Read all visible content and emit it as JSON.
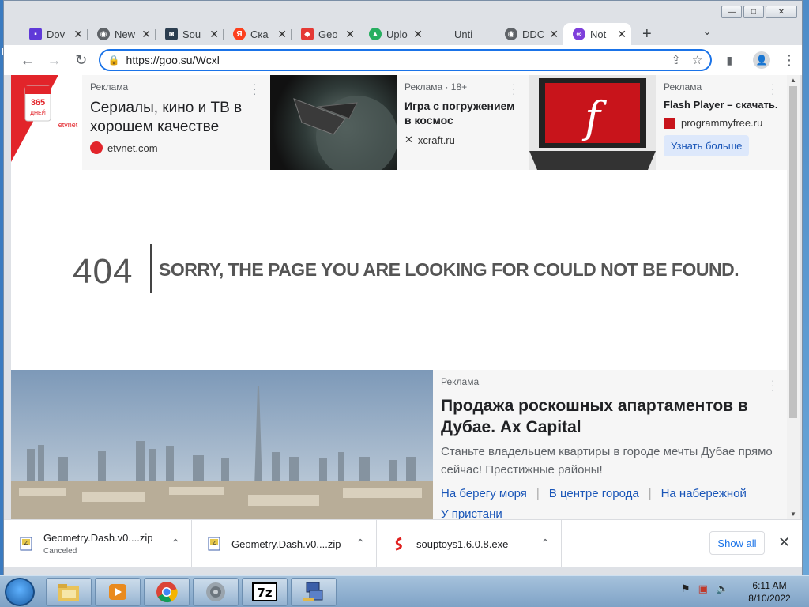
{
  "desktop": {
    "letter": "M"
  },
  "window": {
    "min": "—",
    "max": "□",
    "close": "✕"
  },
  "tabs": [
    {
      "title": "Dov",
      "fav_color": "#5f39d8",
      "fav_glyph": "▪"
    },
    {
      "title": "New",
      "fav_color": "#5f6368",
      "fav_glyph": "◉"
    },
    {
      "title": "Sou",
      "fav_color": "#2c3e50",
      "fav_glyph": "◙"
    },
    {
      "title": "Ска",
      "fav_color": "#fc3f1d",
      "fav_glyph": "Я"
    },
    {
      "title": "Geo",
      "fav_color": "#e53935",
      "fav_glyph": "◆"
    },
    {
      "title": "Uplo",
      "fav_color": "#27ae60",
      "fav_glyph": "▲"
    },
    {
      "title": "Unti",
      "fav_color": "#ffffff",
      "fav_glyph": ""
    },
    {
      "title": "DDC",
      "fav_color": "#5f6368",
      "fav_glyph": "◉"
    },
    {
      "title": "Not",
      "fav_color": "#7e3fdb",
      "fav_glyph": "∞"
    }
  ],
  "tab_close": "✕",
  "new_tab": "+",
  "tab_menu": "⌄",
  "toolbar": {
    "back": "←",
    "forward": "→",
    "reload": "↻",
    "lock": "🔒",
    "url": "https://goo.su/Wcxl",
    "share": "⇪",
    "star": "☆",
    "sidebar": "▮",
    "profile": "👤",
    "menu": "⋮"
  },
  "ads_top": [
    {
      "label": "Реклама",
      "title": "Сериалы, кино и ТВ в хорошем качестве",
      "domain": "etvnet.com",
      "calendar": "365",
      "calendar_sub": "ДНЕЙ",
      "brand": "etvnet"
    },
    {
      "label": "Реклама · 18+",
      "title": "Игра с погружением в космос",
      "domain": "xcraft.ru"
    },
    {
      "label": "Реклама",
      "title": "Flash Player – скачать.",
      "domain": "programmyfree.ru",
      "cta": "Узнать больше"
    }
  ],
  "error": {
    "code": "404",
    "message": "SORRY, THE PAGE YOU ARE LOOKING FOR COULD NOT BE FOUND."
  },
  "big_ad": {
    "label": "Реклама",
    "title": "Продажа роскошных апартаментов в Дубае. Ax Capital",
    "text": "Станьте владельцем квартиры в городе мечты Дубае прямо сейчас! Престижные районы!",
    "links": [
      "На берегу моря",
      "В центре города",
      "На набережной",
      "У пристани"
    ]
  },
  "downloads": [
    {
      "name": "Geometry.Dash.v0....zip",
      "status": "Canceled"
    },
    {
      "name": "Geometry.Dash.v0....zip",
      "status": ""
    },
    {
      "name": "souptoys1.6.0.8.exe",
      "status": ""
    }
  ],
  "downloads_bar": {
    "show_all": "Show all",
    "close": "✕",
    "caret": "⌃"
  },
  "taskbar": {
    "apps": [
      "explorer",
      "media-player",
      "chrome",
      "speaker-app",
      "7zip",
      "network-app"
    ],
    "time": "6:11 AM",
    "date": "8/10/2022"
  }
}
